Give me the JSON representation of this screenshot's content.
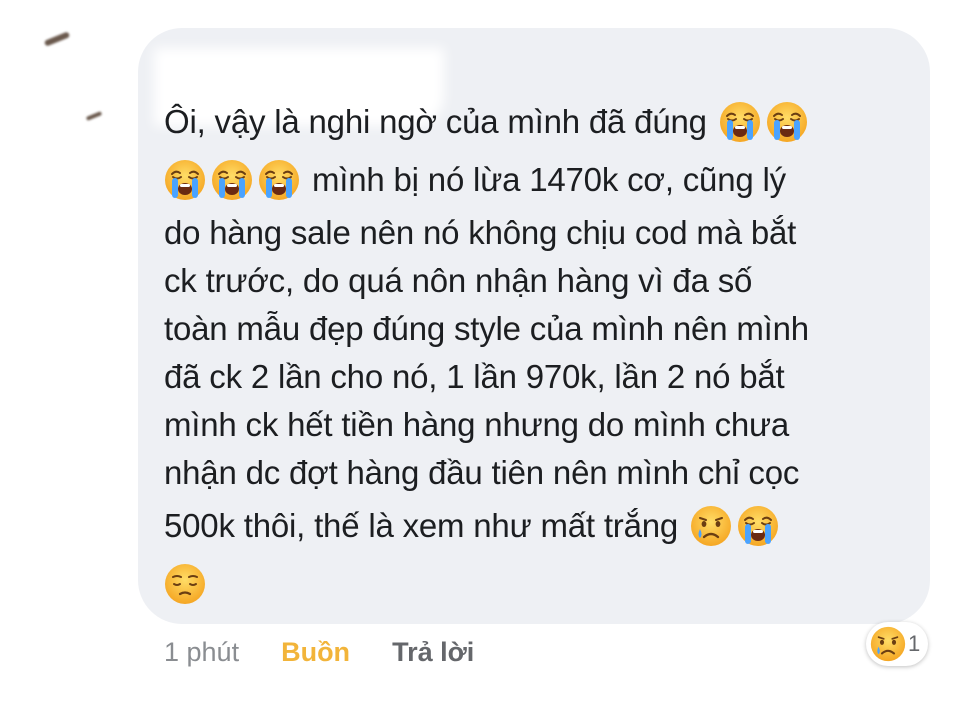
{
  "comment": {
    "lines": [
      "Ôi, vậy là nghi ngờ của mình đã đúng",
      "mình bị nó lừa 1470k cơ, cũng lý",
      "do hàng sale nên nó không chịu cod mà bắt",
      "ck trước, do quá nôn nhận hàng vì đa số",
      "toàn mẫu đẹp đúng style của mình nên mình",
      "đã ck 2 lần cho nó, 1 lần 970k, lần 2 nó bắt",
      "mình ck hết tiền hàng nhưng do mình chưa",
      "nhận dc đợt hàng đầu tiên nên mình chỉ cọc",
      "500k thôi, thế là xem như mất trắng"
    ],
    "emoji": {
      "line1": [
        "loudly-crying-face",
        "loudly-crying-face"
      ],
      "line2": [
        "loudly-crying-face",
        "loudly-crying-face",
        "loudly-crying-face"
      ],
      "line9": [
        "crying-face",
        "loudly-crying-face"
      ],
      "line10": [
        "pensive-face"
      ]
    }
  },
  "meta": {
    "time": "1 phút",
    "reaction_label": "Buồn",
    "reply_label": "Trả lời"
  },
  "reactions": {
    "icon": "sad-reaction-icon",
    "count": "1"
  },
  "colors": {
    "bubble": "#eef0f4",
    "text": "#1c1e21",
    "reaction_active": "#f2b43a",
    "meta": "#8a8d91"
  }
}
